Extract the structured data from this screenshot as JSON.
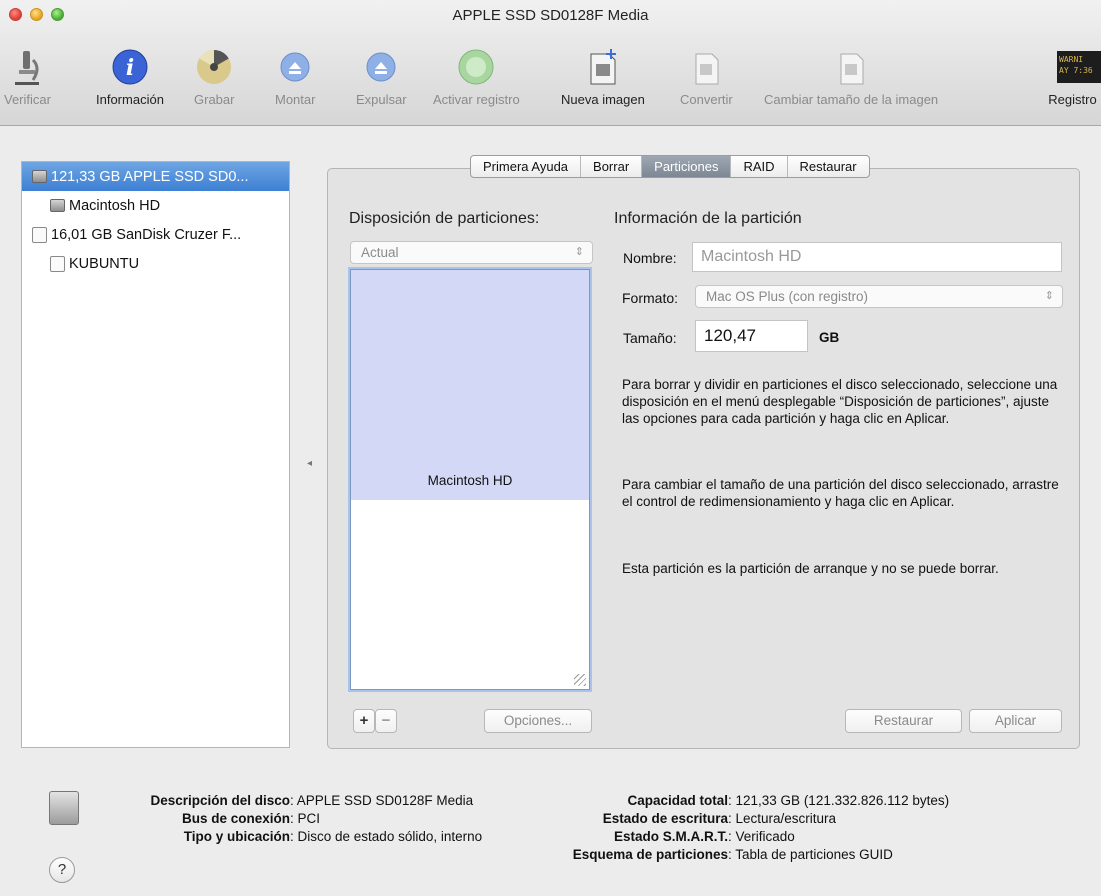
{
  "window": {
    "title": "APPLE SSD SD0128F Media"
  },
  "toolbar": {
    "items": [
      {
        "label": "Verificar",
        "icon": "microscope-icon",
        "enabled": false
      },
      {
        "label": "Información",
        "icon": "info-icon",
        "enabled": true
      },
      {
        "label": "Grabar",
        "icon": "burn-icon",
        "enabled": false
      },
      {
        "label": "Montar",
        "icon": "mount-icon",
        "enabled": false
      },
      {
        "label": "Expulsar",
        "icon": "eject-icon",
        "enabled": false
      },
      {
        "label": "Activar registro",
        "icon": "enable-journaling-icon",
        "enabled": false
      },
      {
        "label": "Nueva imagen",
        "icon": "new-image-icon",
        "enabled": true
      },
      {
        "label": "Convertir",
        "icon": "convert-icon",
        "enabled": false
      },
      {
        "label": "Cambiar tamaño de la imagen",
        "icon": "resize-image-icon",
        "enabled": false
      },
      {
        "label": "Registro",
        "icon": "log-icon",
        "enabled": true
      },
      {
        "label": "WARNI",
        "icon": "log-icon-text"
      },
      {
        "label": "AY 7:36",
        "icon": "log-icon-text"
      }
    ]
  },
  "sidebar": {
    "items": [
      {
        "label": "121,33 GB APPLE SSD SD0...",
        "selected": true,
        "kind": "hd"
      },
      {
        "label": "Macintosh HD",
        "selected": false,
        "kind": "hd"
      },
      {
        "label": "16,01 GB SanDisk Cruzer F...",
        "selected": false,
        "kind": "usb"
      },
      {
        "label": "KUBUNTU",
        "selected": false,
        "kind": "usb"
      }
    ]
  },
  "tabs": [
    "Primera Ayuda",
    "Borrar",
    "Particiones",
    "RAID",
    "Restaurar"
  ],
  "active_tab": "Particiones",
  "layout": {
    "heading": "Disposición de particiones:",
    "popup_value": "Actual",
    "partition_name": "Macintosh HD",
    "partition_fill": 0.55
  },
  "partition_info": {
    "heading": "Información de la partición",
    "name_label": "Nombre:",
    "name_value": "Macintosh HD",
    "format_label": "Formato:",
    "format_value": "Mac OS Plus (con registro)",
    "size_label": "Tamaño:",
    "size_value": "120,47",
    "size_unit": "GB",
    "help": [
      "Para borrar y dividir en particiones el disco seleccionado, seleccione una disposición en el menú desplegable “Disposición de particiones”, ajuste las opciones para cada partición y haga clic en Aplicar.",
      "Para cambiar el tamaño de una partición del disco seleccionado, arrastre el control de redimensionamiento y haga clic en Aplicar.",
      "Esta partición es la partición de arranque y no se puede borrar."
    ]
  },
  "buttons": {
    "add": "+",
    "remove": "−",
    "options": "Opciones...",
    "restore": "Restaurar",
    "apply": "Aplicar"
  },
  "disk_info": {
    "left": [
      {
        "key": "Descripción del disco",
        "value": "APPLE SSD SD0128F Media"
      },
      {
        "key": "Bus de conexión",
        "value": "PCI"
      },
      {
        "key": "Tipo y ubicación",
        "value": "Disco de estado sólido, interno"
      }
    ],
    "right": [
      {
        "key": "Capacidad total",
        "value": "121,33 GB (121.332.826.112 bytes)"
      },
      {
        "key": "Estado de escritura",
        "value": "Lectura/escritura"
      },
      {
        "key": "Estado S.M.A.R.T.",
        "value": "Verificado"
      },
      {
        "key": "Esquema de particiones",
        "value": "Tabla de particiones GUID"
      }
    ],
    "separator": " : "
  },
  "help_button": "?"
}
